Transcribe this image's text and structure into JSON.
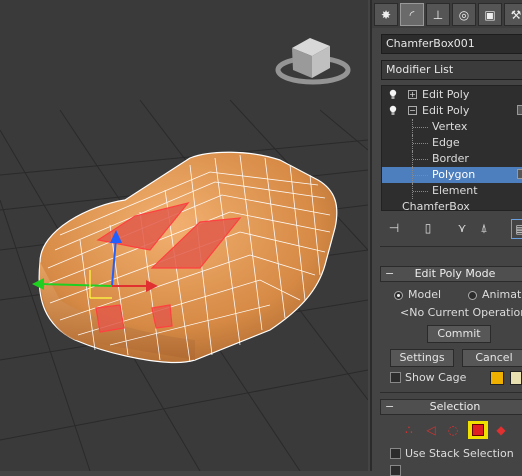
{
  "object_name": "ChamferBox001",
  "modifier_list_label": "Modifier List",
  "stack": {
    "items": [
      {
        "label": "Edit Poly"
      },
      {
        "label": "Edit Poly"
      },
      {
        "label": "Vertex"
      },
      {
        "label": "Edge"
      },
      {
        "label": "Border"
      },
      {
        "label": "Polygon"
      },
      {
        "label": "Element"
      },
      {
        "label": "ChamferBox"
      }
    ]
  },
  "edit_poly_mode": {
    "title": "Edit Poly Mode",
    "model_label": "Model",
    "animate_label": "Animate",
    "current_operation": "<No Current Operation>",
    "commit_label": "Commit",
    "settings_label": "Settings",
    "cancel_label": "Cancel",
    "show_cage_label": "Show Cage",
    "cage_color_1": "#f0b000",
    "cage_color_2": "#e8e0b0"
  },
  "selection": {
    "title": "Selection",
    "use_stack_label": "Use Stack Selection"
  },
  "colors": {
    "selection_highlight": "#4d7ebd",
    "mesh": "#d9934e",
    "selected_face": "#e05a4a"
  }
}
